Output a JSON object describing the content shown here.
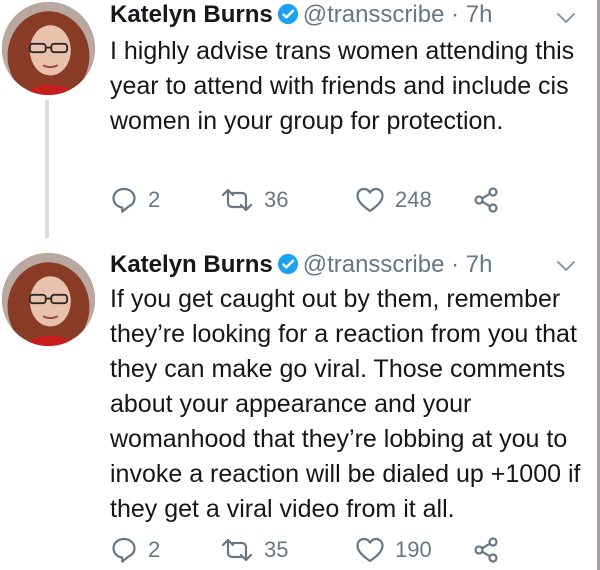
{
  "tweets": [
    {
      "author_name": "Katelyn Burns",
      "handle": "@transscribe",
      "separator": "·",
      "time": "7h",
      "text": "I highly advise trans women attending this year to attend with friends and include cis women in your group for protection.",
      "replies": "2",
      "retweets": "36",
      "likes": "248"
    },
    {
      "author_name": "Katelyn Burns",
      "handle": "@transscribe",
      "separator": "·",
      "time": "7h",
      "text": "If you get caught out by them, remember they’re looking for a reaction from you that they can make go viral. Those comments about your appearance and your womanhood that they’re lobbing at you to invoke a reaction will be dialed up +1000 if they get a viral video from it all.",
      "replies": "2",
      "retweets": "35",
      "likes": "190"
    }
  ],
  "icons": {
    "verified": "verified-badge-icon",
    "menu": "chevron-down-icon",
    "reply": "reply-icon",
    "retweet": "retweet-icon",
    "like": "heart-icon",
    "share": "share-icon"
  },
  "colors": {
    "text": "#14171a",
    "secondary": "#657786",
    "verified": "#1da1f2",
    "thread_line": "#d7dde2"
  }
}
